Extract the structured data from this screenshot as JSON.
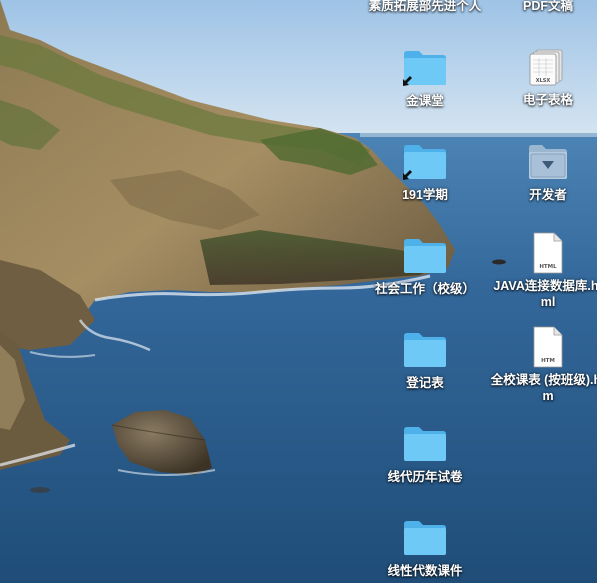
{
  "desktop": {
    "left_column": [
      {
        "label": "素质拓展部先进个人",
        "type": "folder",
        "alias": false,
        "partial_top": true
      },
      {
        "label": "金课堂",
        "type": "folder",
        "alias": true
      },
      {
        "label": "191学期",
        "type": "folder",
        "alias": true
      },
      {
        "label": "社会工作（校级）",
        "type": "folder",
        "alias": false
      },
      {
        "label": "登记表",
        "type": "folder",
        "alias": false
      },
      {
        "label": "线代历年试卷",
        "type": "folder",
        "alias": false
      },
      {
        "label": "线性代数课件",
        "type": "folder",
        "alias": false
      }
    ],
    "right_column": [
      {
        "label": "PDF文稿",
        "type": "folder",
        "alias": false,
        "partial_top": true
      },
      {
        "label": "电子表格",
        "type": "spreadsheet",
        "file_tag": "XLSX"
      },
      {
        "label": "开发者",
        "type": "developer-folder"
      },
      {
        "label": "JAVA连接数据库.html",
        "type": "document",
        "file_tag": "HTML"
      },
      {
        "label": "全校课表 (按班级).htm",
        "type": "document",
        "file_tag": "HTM"
      }
    ]
  },
  "colors": {
    "folder_front": "#6ec9f7",
    "folder_back": "#4fb1ea",
    "sky_top": "#a9c8e6",
    "sea": "#2d5b86"
  }
}
